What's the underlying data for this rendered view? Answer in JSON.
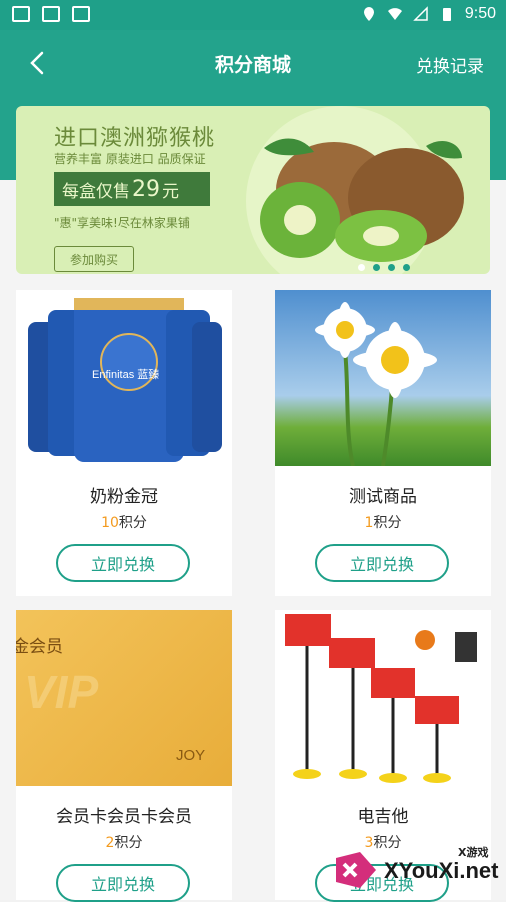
{
  "status_bar": {
    "time": "9:50"
  },
  "header": {
    "title": "积分商城",
    "right_link": "兑换记录"
  },
  "banner": {
    "title": "进口澳洲猕猴桃",
    "subtitle": "营养丰富  原装进口  品质保证",
    "price_prefix": "每盒仅售",
    "price_value": "29",
    "price_unit": "元",
    "tagline": "\"惠\"享美味!尽在林家果铺",
    "button": "参加购买",
    "pagination": {
      "total": 4,
      "active": 2
    }
  },
  "products": [
    {
      "name": "奶粉金冠",
      "points_value": "10",
      "points_unit": "积分",
      "button": "立即兑换",
      "image_text": "Enfinitas 蓝臻"
    },
    {
      "name": "测试商品",
      "points_value": "1",
      "points_unit": "积分",
      "button": "立即兑换",
      "image_text": ""
    },
    {
      "name": "会员卡会员卡会员",
      "points_value": "2",
      "points_unit": "积分",
      "button": "立即兑换",
      "image_text": "金会员"
    },
    {
      "name": "电吉他",
      "points_value": "3",
      "points_unit": "积分",
      "button": "立即兑换",
      "image_text": ""
    }
  ],
  "watermark": {
    "brand": "XYouXi.net",
    "tag": "X游戏"
  },
  "colors": {
    "primary": "#1fa089",
    "accent_points": "#f39a1e",
    "banner_bg": "#d9efb5"
  }
}
